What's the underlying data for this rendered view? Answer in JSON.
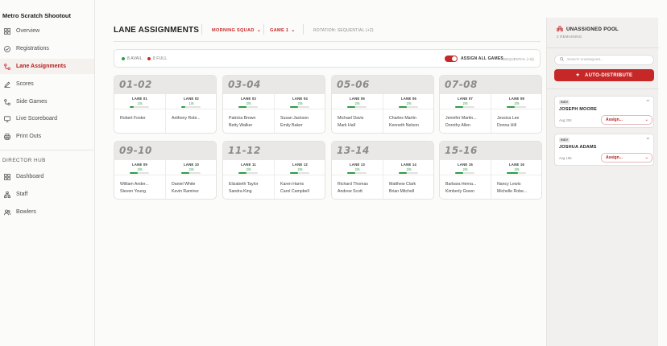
{
  "app": {
    "title": "Metro Scratch Shootout"
  },
  "sidebar": {
    "items": [
      {
        "label": "Overview",
        "icon": "grid-icon"
      },
      {
        "label": "Registrations",
        "icon": "check-circle-icon"
      },
      {
        "label": "Lane Assignments",
        "icon": "route-icon",
        "active": true
      },
      {
        "label": "Scores",
        "icon": "edit-icon"
      },
      {
        "label": "Side Games",
        "icon": "route-icon"
      },
      {
        "label": "Live Scoreboard",
        "icon": "monitor-icon"
      },
      {
        "label": "Print Outs",
        "icon": "printer-icon"
      }
    ],
    "section_label": "DIRECTOR HUB",
    "hub_items": [
      {
        "label": "Dashboard",
        "icon": "grid-icon"
      },
      {
        "label": "Staff",
        "icon": "network-icon"
      },
      {
        "label": "Bowlers",
        "icon": "users-icon"
      }
    ]
  },
  "header": {
    "title": "LANE ASSIGNMENTS",
    "squad": "MORNING SQUAD",
    "game": "GAME 1",
    "rotation": "ROTATION: SEQUENTIAL (+2)"
  },
  "status": {
    "avail": "8 AVAIL",
    "full": "0 FULL",
    "assign_all": "ASSIGN ALL GAMES",
    "assign_all_sub": "(SEQUENTIAL (+2))",
    "assign_all_enabled": true
  },
  "colors": {
    "accent": "#c62828",
    "good": "#2e9b46"
  },
  "pairs": [
    {
      "name": "01-02",
      "lanes": [
        {
          "label": "LANE 01",
          "count": "1/5",
          "fill": 0.2,
          "bowlers": [
            "Robert Foster"
          ]
        },
        {
          "label": "LANE 02",
          "count": "1/5",
          "fill": 0.2,
          "bowlers": [
            "Anthony Robi..."
          ]
        }
      ]
    },
    {
      "name": "03-04",
      "lanes": [
        {
          "label": "LANE 03",
          "count": "2/5",
          "fill": 0.4,
          "bowlers": [
            "Patricia Brown",
            "Betty Walker"
          ]
        },
        {
          "label": "LANE 04",
          "count": "2/5",
          "fill": 0.4,
          "bowlers": [
            "Susan Jackson",
            "Emily Baker"
          ]
        }
      ]
    },
    {
      "name": "05-06",
      "lanes": [
        {
          "label": "LANE 05",
          "count": "2/5",
          "fill": 0.4,
          "bowlers": [
            "Michael Davis",
            "Mark Hall"
          ]
        },
        {
          "label": "LANE 06",
          "count": "2/5",
          "fill": 0.4,
          "bowlers": [
            "Charles Martin",
            "Kenneth Nelson"
          ]
        }
      ]
    },
    {
      "name": "07-08",
      "lanes": [
        {
          "label": "LANE 07",
          "count": "2/5",
          "fill": 0.4,
          "bowlers": [
            "Jennifer Martin...",
            "Dorothy Allen"
          ]
        },
        {
          "label": "LANE 08",
          "count": "2/5",
          "fill": 0.4,
          "bowlers": [
            "Jessica Lee",
            "Donna Hill"
          ]
        }
      ]
    },
    {
      "name": "09-10",
      "lanes": [
        {
          "label": "LANE 09",
          "count": "2/5",
          "fill": 0.4,
          "bowlers": [
            "William Ander...",
            "Steven Young"
          ]
        },
        {
          "label": "LANE 10",
          "count": "2/5",
          "fill": 0.4,
          "bowlers": [
            "Daniel White",
            "Kevin Ramirez"
          ]
        }
      ]
    },
    {
      "name": "11-12",
      "lanes": [
        {
          "label": "LANE 11",
          "count": "2/5",
          "fill": 0.4,
          "bowlers": [
            "Elizabeth Taylor",
            "Sandra King"
          ]
        },
        {
          "label": "LANE 12",
          "count": "2/5",
          "fill": 0.4,
          "bowlers": [
            "Karen Harris",
            "Carol Campbell"
          ]
        }
      ]
    },
    {
      "name": "13-14",
      "lanes": [
        {
          "label": "LANE 13",
          "count": "2/5",
          "fill": 0.4,
          "bowlers": [
            "Richard Thomas",
            "Andrew Scott"
          ]
        },
        {
          "label": "LANE 14",
          "count": "2/5",
          "fill": 0.4,
          "bowlers": [
            "Matthew Clark",
            "Brian Mitchell"
          ]
        }
      ]
    },
    {
      "name": "15-16",
      "lanes": [
        {
          "label": "LANE 15",
          "count": "2/5",
          "fill": 0.4,
          "bowlers": [
            "Barbara Herna...",
            "Kimberly Green"
          ]
        },
        {
          "label": "LANE 16",
          "count": "3/5",
          "fill": 0.6,
          "bowlers": [
            "Nancy Lewis",
            "Michelle Robe..."
          ]
        }
      ]
    }
  ],
  "pool": {
    "title": "UNASSIGNED POOL",
    "subtitle": "2 REMAINING",
    "search_placeholder": "Search unassigned...",
    "auto_button": "AUTO-DISTRIBUTE",
    "bowlers": [
      {
        "badge": "INDV",
        "name": "JOSEPH MOORE",
        "avg": "Avg 204",
        "assign": "Assign..."
      },
      {
        "badge": "INDV",
        "name": "JOSHUA ADAMS",
        "avg": "Avg 195",
        "assign": "Assign..."
      }
    ]
  }
}
